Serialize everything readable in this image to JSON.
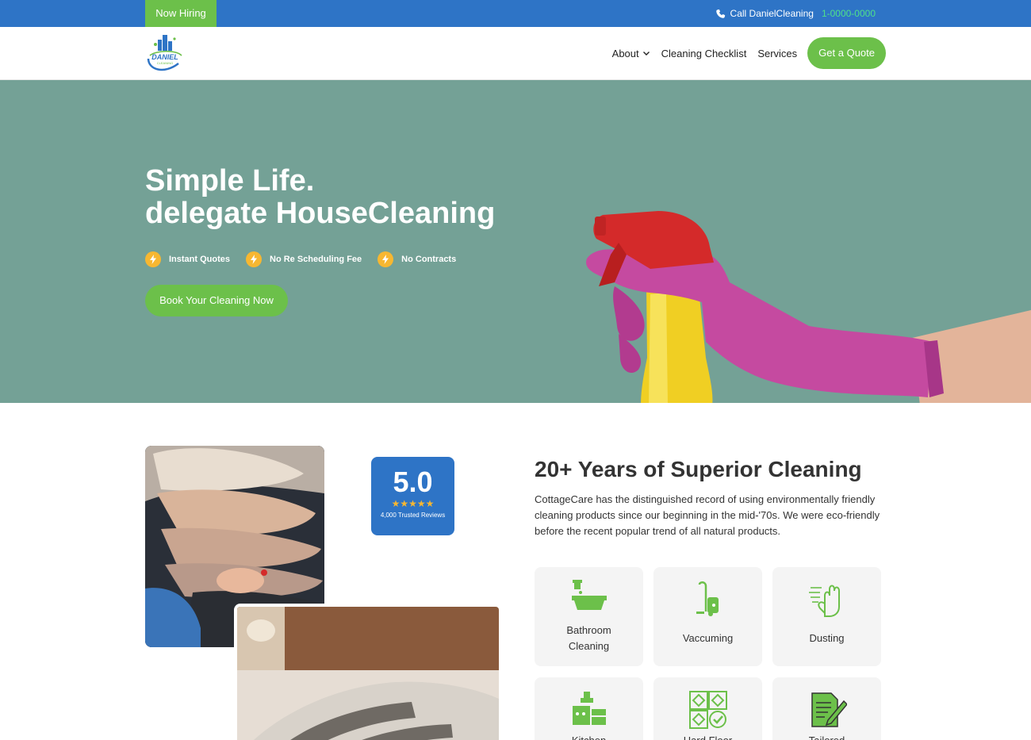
{
  "topbar": {
    "hiring_label": "Now Hiring",
    "call_label": "Call DanielCleaning",
    "phone": "1-0000-0000"
  },
  "logo": {
    "brand_top": "DANIEL",
    "brand_bottom": "CLEANING"
  },
  "nav": {
    "items": [
      "About",
      "Cleaning Checklist",
      "Services"
    ],
    "quote_label": "Get a Quote"
  },
  "hero": {
    "title_line1": "Simple Life.",
    "title_line2": "delegate HouseCleaning",
    "features": [
      "Instant Quotes",
      "No Re Scheduling Fee",
      "No Contracts"
    ],
    "cta_label": "Book Your Cleaning Now"
  },
  "rating": {
    "score": "5.0",
    "stars": "★★★★★",
    "reviews": "4,000 Trusted Reviews"
  },
  "about": {
    "title": "20+ Years of Superior Cleaning",
    "text": "CottageCare has the distinguished record of using environmentally friendly cleaning products since our beginning in the mid-'70s. We were eco-friendly before the recent popular trend of all natural products."
  },
  "services": [
    {
      "line1": "Bathroom",
      "line2": "Cleaning",
      "icon": "bathtub-icon"
    },
    {
      "line1": "Vaccuming",
      "line2": "",
      "icon": "vacuum-icon"
    },
    {
      "line1": "Dusting",
      "line2": "",
      "icon": "dusting-glove-icon"
    },
    {
      "line1": "Kitchen",
      "line2": "",
      "icon": "kitchen-icon"
    },
    {
      "line1": "Hard Floor",
      "line2": "",
      "icon": "floor-tiles-icon"
    },
    {
      "line1": "Tailored",
      "line2": "",
      "icon": "checklist-icon"
    }
  ],
  "colors": {
    "brand_blue": "#2e74c6",
    "accent_green": "#6cc04a",
    "hero_teal": "#74a196",
    "bolt_yellow": "#f7b731"
  }
}
